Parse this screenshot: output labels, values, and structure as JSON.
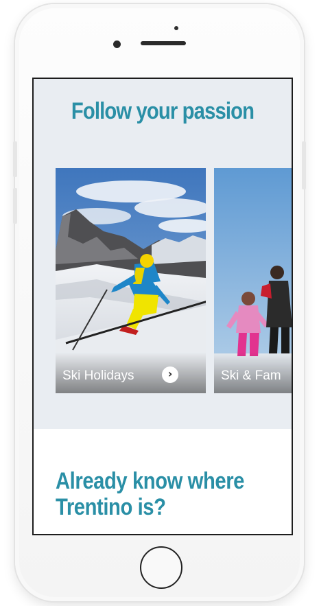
{
  "device": {
    "name": "smartphone",
    "frame_color": "#f6f6f6"
  },
  "screen": {
    "passion": {
      "title": "Follow your passion",
      "cards": [
        {
          "label": "Ski Holidays",
          "icon": "chevron-right-circle-icon"
        },
        {
          "label": "Ski & Fam"
        }
      ]
    },
    "discover": {
      "title_line1": "Already know where",
      "title_line2": "Trentino is?"
    }
  },
  "colors": {
    "accent": "#2a8fa6",
    "section_background": "#e9edf2"
  }
}
